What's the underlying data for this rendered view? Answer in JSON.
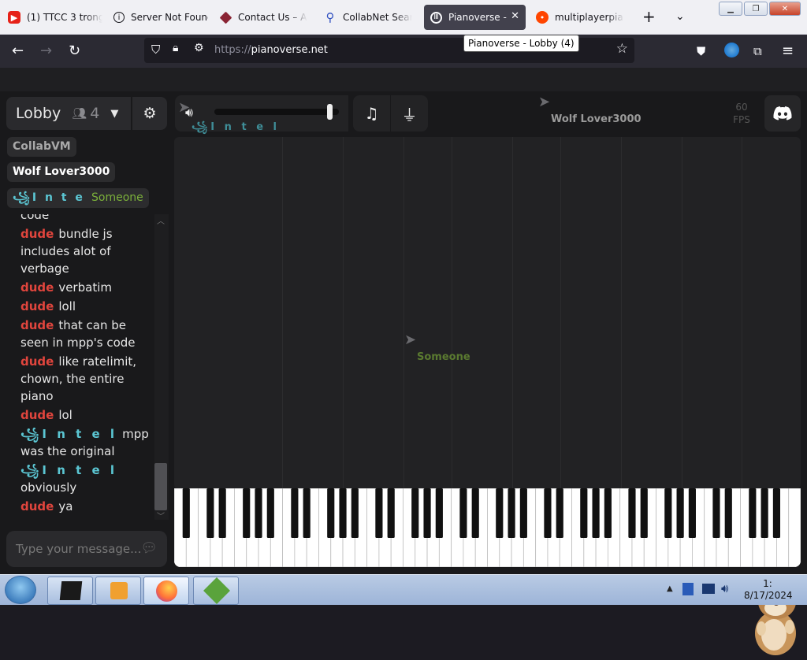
{
  "browser": {
    "tabs": [
      {
        "title": "(1) TTCC 3 trong",
        "icon": "youtube-icon"
      },
      {
        "title": "Server Not Found",
        "icon": "info-icon"
      },
      {
        "title": "Contact Us – Am",
        "icon": "site-icon"
      },
      {
        "title": "CollabNet SearXNG",
        "icon": "search-icon"
      },
      {
        "title": "Pianoverse - ",
        "icon": "pianoverse-icon",
        "active": true
      },
      {
        "title": "multiplayerpiano",
        "icon": "reddit-icon"
      }
    ],
    "tooltip": "Pianoverse - Lobby (4)",
    "url_scheme": "https://",
    "url_host": "pianoverse.net"
  },
  "app": {
    "room_name": "Lobby",
    "user_count": "4",
    "fps_value": "60",
    "fps_label": "FPS",
    "volume_level": 0.95,
    "users": [
      {
        "name": "CollabVM",
        "color": "#a9a9a9",
        "bg": "#2c2c2e"
      },
      {
        "name": "Wolf Lover3000",
        "color": "#ffffff",
        "bg": "#2c2c2e"
      },
      {
        "name": "꧁I n t e l",
        "color": "#5bc6d3",
        "bg": "#2c2c2e"
      },
      {
        "name": "Someone",
        "color": "#7bb03a",
        "bg": "#2c2c2e"
      }
    ],
    "cursors": {
      "intel": "꧁I n t e l",
      "wolf": "Wolf Lover3000",
      "someone": "Someone"
    },
    "chat_partial_top": "code",
    "chat": [
      {
        "user": "dude",
        "text": "bundle js includes alot of verbage"
      },
      {
        "user": "dude",
        "text": "verbatim"
      },
      {
        "user": "dude",
        "text": "loll"
      },
      {
        "user": "dude",
        "text": "that can be seen in mpp's code"
      },
      {
        "user": "dude",
        "text": "like ratelimit, chown, the entire piano"
      },
      {
        "user": "dude",
        "text": "lol"
      },
      {
        "user": "꧁I n t e l",
        "text": "mpp was the original",
        "intel": true
      },
      {
        "user": "꧁I n t e l",
        "text": "obviously",
        "intel": true
      },
      {
        "user": "dude",
        "text": "ya"
      }
    ],
    "chat_placeholder": "Type your message..."
  },
  "taskbar": {
    "time": "1:",
    "date": "8/17/2024"
  }
}
